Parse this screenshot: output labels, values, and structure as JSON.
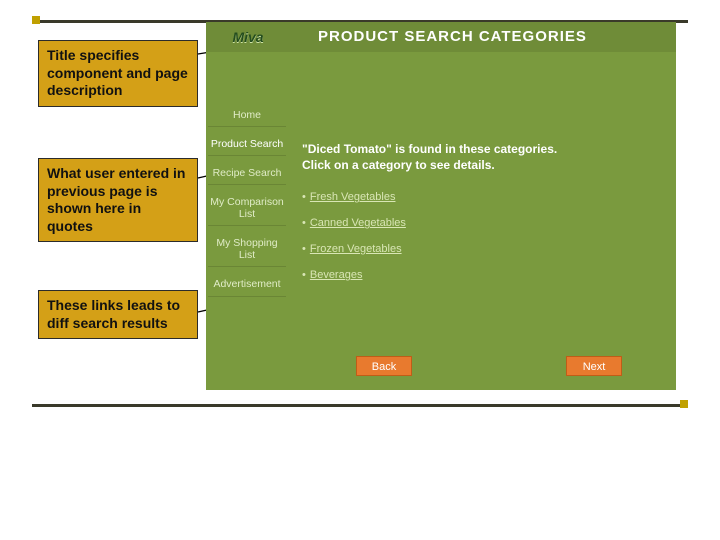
{
  "callouts": {
    "c1": "Title specifies component and page description",
    "c2": "What user entered in previous page is shown here in quotes",
    "c3": "These links leads to diff search results"
  },
  "app": {
    "logo": "Miva",
    "title": "PRODUCT SEARCH CATEGORIES",
    "nav": {
      "home": "Home",
      "product_search": "Product Search",
      "recipe_search": "Recipe Search",
      "comparison": "My Comparison List",
      "shopping": "My Shopping List",
      "advert": "Advertisement"
    },
    "found_prefix": "\"Diced Tomato\" is found in these categories.",
    "found_suffix": "Click on a category to see details.",
    "categories": {
      "c0": "Fresh Vegetables",
      "c1": "Canned Vegetables",
      "c2": "Frozen Vegetables",
      "c3": "Beverages"
    },
    "buttons": {
      "back": "Back",
      "next": "Next"
    }
  }
}
